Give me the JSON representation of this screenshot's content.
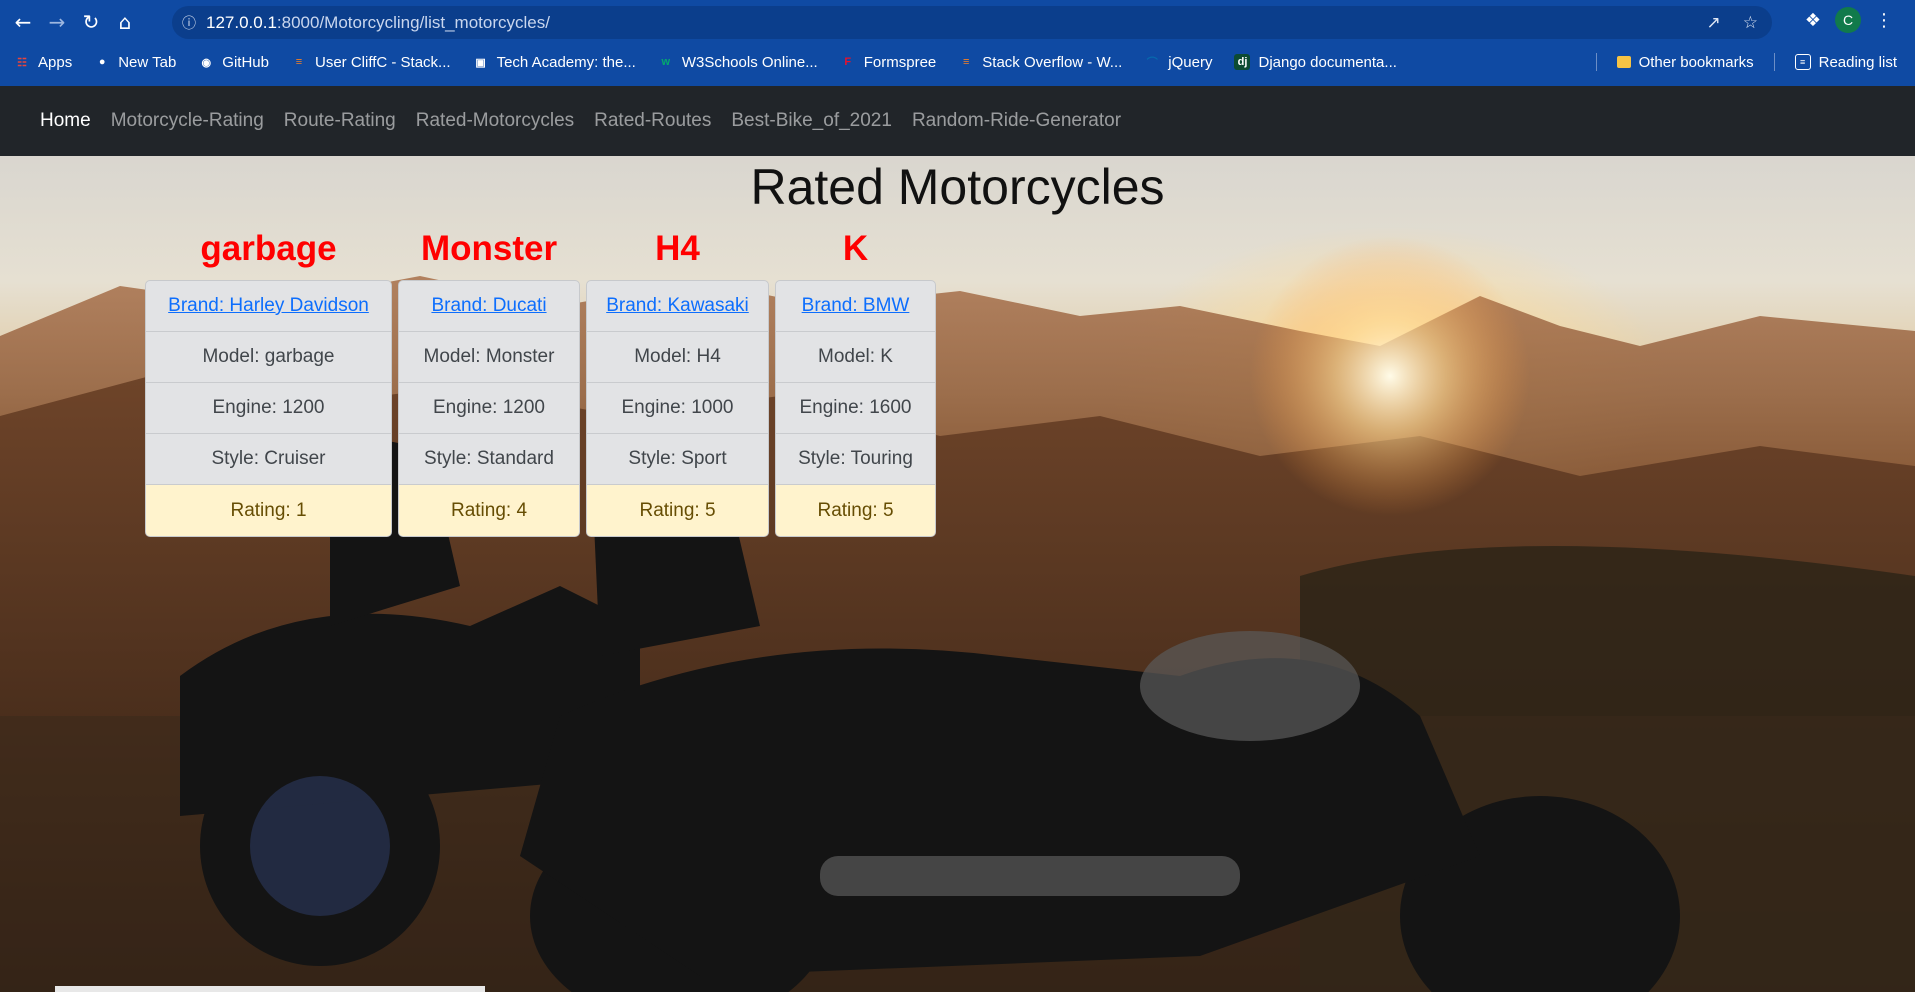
{
  "browser": {
    "url_host": "127.0.0.1",
    "url_path": ":8000/Motorcycling/list_motorcycles/",
    "profile_initial": "C",
    "bookmarks": [
      {
        "label": "Apps",
        "icon": "apps-grid-icon",
        "color": "#e8453c"
      },
      {
        "label": "New Tab",
        "icon": "globe-icon",
        "color": "#ffffff"
      },
      {
        "label": "GitHub",
        "icon": "github-icon",
        "color": "#ffffff"
      },
      {
        "label": "User CliffC - Stack...",
        "icon": "stackoverflow-icon",
        "color": "#f48024"
      },
      {
        "label": "Tech Academy: the...",
        "icon": "tech-academy-icon",
        "color": "#ffffff"
      },
      {
        "label": "W3Schools Online...",
        "icon": "w3schools-icon",
        "color": "#04aa6d"
      },
      {
        "label": "Formspree",
        "icon": "formspree-icon",
        "color": "#e5122e"
      },
      {
        "label": "Stack Overflow - W...",
        "icon": "stackoverflow-icon",
        "color": "#f48024"
      },
      {
        "label": "jQuery",
        "icon": "jquery-icon",
        "color": "#0769ad"
      },
      {
        "label": "Django documenta...",
        "icon": "django-icon",
        "color": "#0c4b33"
      }
    ],
    "other_bookmarks": "Other bookmarks",
    "reading_list": "Reading list"
  },
  "navbar": {
    "links": [
      {
        "label": "Home",
        "active": true
      },
      {
        "label": "Motorcycle-Rating",
        "active": false
      },
      {
        "label": "Route-Rating",
        "active": false
      },
      {
        "label": "Rated-Motorcycles",
        "active": false
      },
      {
        "label": "Rated-Routes",
        "active": false
      },
      {
        "label": "Best-Bike_of_2021",
        "active": false
      },
      {
        "label": "Random-Ride-Generator",
        "active": false
      }
    ]
  },
  "page": {
    "title": "Rated Motorcycles",
    "motorcycles": [
      {
        "heading": "garbage",
        "brand": "Brand: Harley Davidson",
        "model": "Model: garbage",
        "engine": "Engine: 1200",
        "style": "Style: Cruiser",
        "rating": "Rating: 1"
      },
      {
        "heading": "Monster",
        "brand": "Brand: Ducati",
        "model": "Model: Monster",
        "engine": "Engine: 1200",
        "style": "Style: Standard",
        "rating": "Rating: 4"
      },
      {
        "heading": "H4",
        "brand": "Brand: Kawasaki",
        "model": "Model: H4",
        "engine": "Engine: 1000",
        "style": "Style: Sport",
        "rating": "Rating: 5"
      },
      {
        "heading": "K",
        "brand": "Brand: BMW",
        "model": "Model: K",
        "engine": "Engine: 1600",
        "style": "Style: Touring",
        "rating": "Rating: 5"
      }
    ]
  },
  "colors": {
    "browser_blue": "#0f4aa3",
    "navbar_bg": "#212529",
    "heading_red": "#ff0000",
    "link_blue": "#0d6efd",
    "rating_bg": "#fff3cd"
  }
}
